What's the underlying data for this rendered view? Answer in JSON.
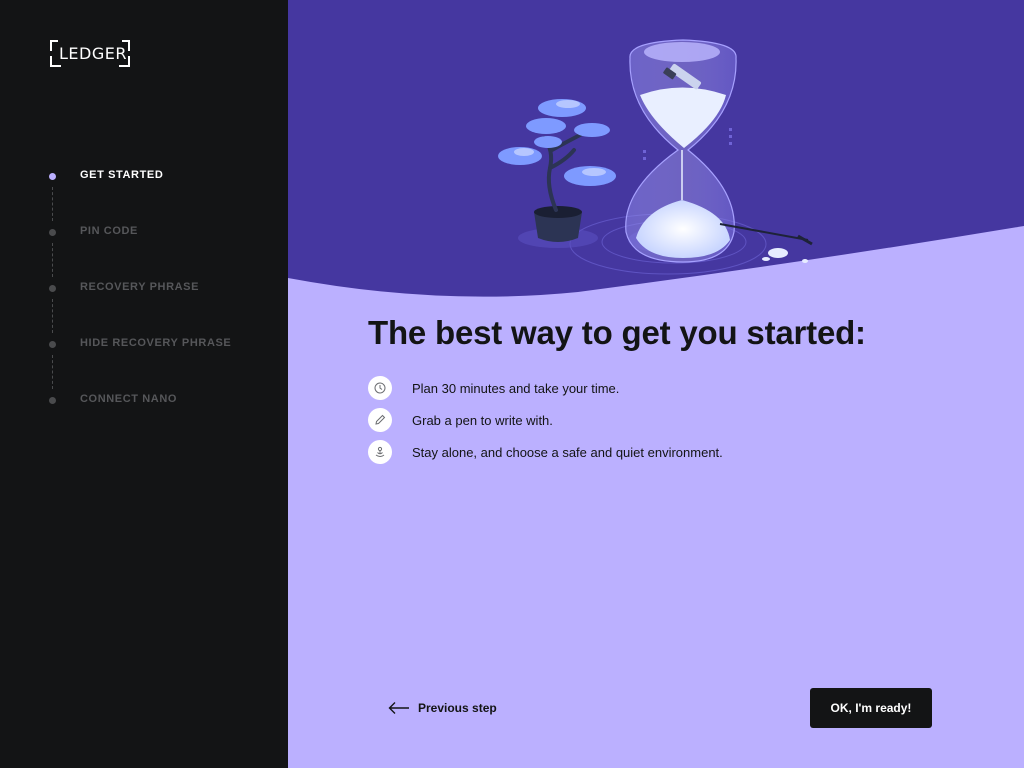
{
  "sidebar": {
    "logo_text": "LEDGER",
    "steps": [
      {
        "label": "GET STARTED",
        "active": true
      },
      {
        "label": "PIN CODE",
        "active": false
      },
      {
        "label": "RECOVERY PHRASE",
        "active": false
      },
      {
        "label": "HIDE RECOVERY PHRASE",
        "active": false
      },
      {
        "label": "CONNECT NANO",
        "active": false
      }
    ]
  },
  "main": {
    "title": "The best way to get you started:",
    "tips": [
      {
        "icon": "clock-icon",
        "text": "Plan 30 minutes and take your time."
      },
      {
        "icon": "pen-icon",
        "text": "Grab a pen to write with."
      },
      {
        "icon": "lotus-icon",
        "text": "Stay alone, and choose a safe and quiet environment."
      }
    ],
    "previous_label": "Previous step",
    "ok_label": "OK, I'm ready!"
  },
  "colors": {
    "sidebar_bg": "#131415",
    "main_bg": "#bbb0ff",
    "hero_bg": "#4537a0",
    "active_dot": "#bbb0ff",
    "inactive_text": "#56575a",
    "button_bg": "#131415"
  }
}
